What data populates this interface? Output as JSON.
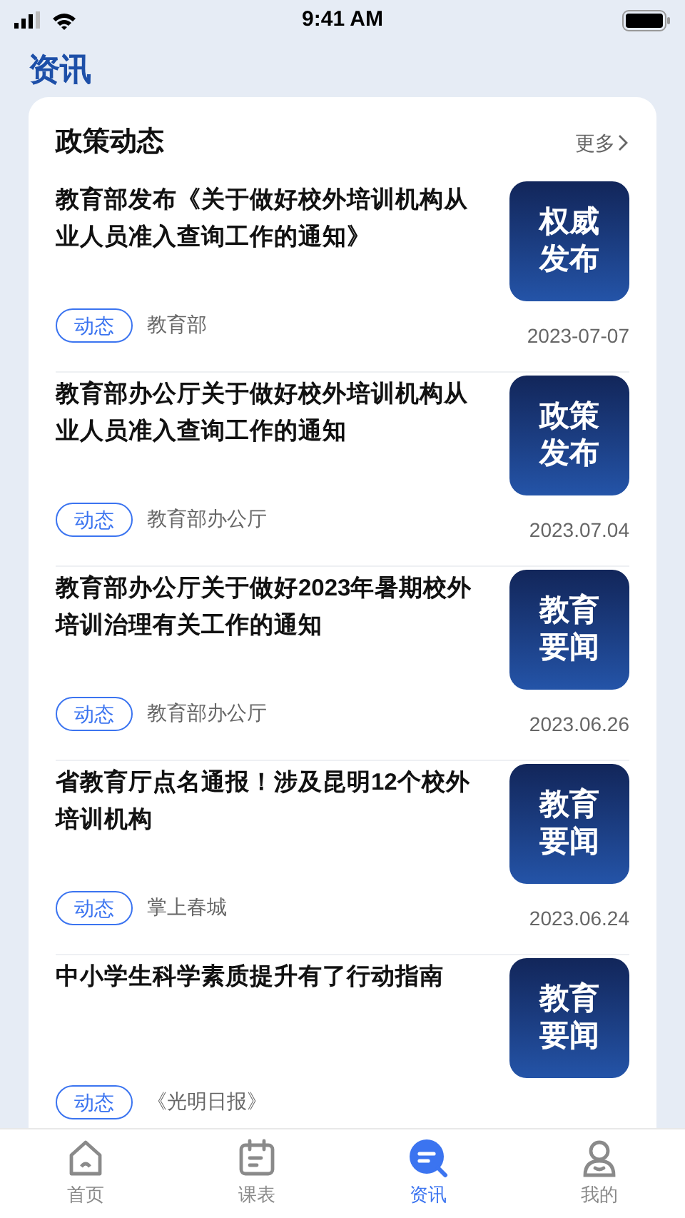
{
  "status_bar": {
    "time": "9:41 AM"
  },
  "page_title": "资讯",
  "section": {
    "title": "政策动态",
    "more": "更多"
  },
  "news": [
    {
      "title": "教育部发布《关于做好校外培训机构从业人员准入查询工作的通知》",
      "tag": "动态",
      "source": "教育部",
      "date": "2023-07-07",
      "badge": "权威发布"
    },
    {
      "title": "教育部办公厅关于做好校外培训机构从业人员准入查询工作的通知",
      "tag": "动态",
      "source": "教育部办公厅",
      "date": "2023.07.04",
      "badge": "政策发布"
    },
    {
      "title": "教育部办公厅关于做好2023年暑期校外培训治理有关工作的通知",
      "tag": "动态",
      "source": "教育部办公厅",
      "date": "2023.06.26",
      "badge": "教育要闻"
    },
    {
      "title": "省教育厅点名通报！涉及昆明12个校外培训机构",
      "tag": "动态",
      "source": "掌上春城",
      "date": "2023.06.24",
      "badge": "教育要闻"
    },
    {
      "title": "中小学生科学素质提升有了行动指南",
      "tag": "动态",
      "source": "《光明日报》",
      "badge": "教育要闻"
    }
  ],
  "tab_bar": [
    {
      "kind": "home",
      "label": "首页",
      "selected": false
    },
    {
      "kind": "calendar",
      "label": "课表",
      "selected": false
    },
    {
      "kind": "news",
      "label": "资讯",
      "selected": true
    },
    {
      "kind": "profile",
      "label": "我的",
      "selected": false
    }
  ]
}
